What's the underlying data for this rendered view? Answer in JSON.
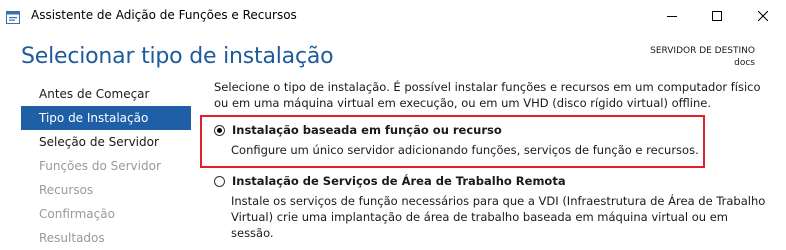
{
  "window": {
    "title": "Assistente de Adição de Funções e Recursos"
  },
  "page": {
    "heading": "Selecionar tipo de instalação",
    "destination_label": "SERVIDOR DE DESTINO",
    "destination_value": "docs"
  },
  "nav": {
    "items": [
      {
        "label": "Antes de Começar",
        "state": "enabled"
      },
      {
        "label": "Tipo de Instalação",
        "state": "active"
      },
      {
        "label": "Seleção de Servidor",
        "state": "enabled"
      },
      {
        "label": "Funções do Servidor",
        "state": "disabled"
      },
      {
        "label": "Recursos",
        "state": "disabled"
      },
      {
        "label": "Confirmação",
        "state": "disabled"
      },
      {
        "label": "Resultados",
        "state": "disabled"
      }
    ]
  },
  "content": {
    "intro": "Selecione o tipo de instalação. É possível instalar funções e recursos em um computador físico ou em uma máquina virtual em execução, ou em um VHD (disco rígido virtual) offline.",
    "options": [
      {
        "title": "Instalação baseada em função ou recurso",
        "description": "Configure um único servidor adicionando funções, serviços de função e recursos.",
        "selected": true
      },
      {
        "title": "Instalação de Serviços de Área de Trabalho Remota",
        "description": "Instale os serviços de função necessários para que a VDI (Infraestrutura de Área de Trabalho Virtual) crie uma implantação de área de trabalho baseada em máquina virtual ou em sessão.",
        "selected": false
      }
    ]
  },
  "colors": {
    "accent": "#1e5fa8",
    "heading": "#1e5a9c",
    "highlight_border": "#e0202a"
  }
}
